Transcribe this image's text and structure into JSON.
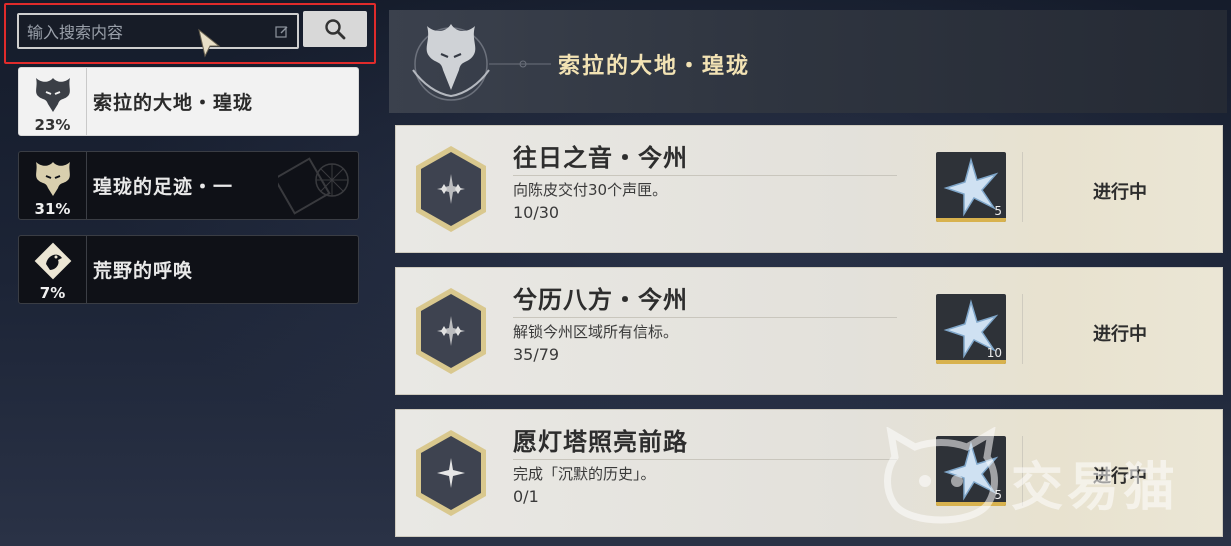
{
  "search": {
    "placeholder": "输入搜索内容",
    "button_icon": "search-icon",
    "edit_icon": "edit-icon",
    "highlight_color": "#e02b2b"
  },
  "categories": [
    {
      "label": "索拉的大地・瑝珑",
      "percent": "23%",
      "active": true,
      "icon": "dragon-emblem-icon"
    },
    {
      "label": "瑝珑的足迹・一",
      "percent": "31%",
      "active": false,
      "icon": "dragon-emblem-icon"
    },
    {
      "label": "荒野的呼唤",
      "percent": "7%",
      "active": false,
      "icon": "bird-emblem-icon"
    }
  ],
  "header": {
    "title": "索拉的大地・瑝珑",
    "title_color": "#f3e3b4",
    "icon": "dragon-emblem-icon"
  },
  "achievements": [
    {
      "name": "往日之音・今州",
      "desc": "向陈皮交付30个声匣。",
      "progress": "10/30",
      "reward_qty": "5",
      "reward_icon": "astrite-star-icon",
      "status": "进行中"
    },
    {
      "name": "兮历八方・今州",
      "desc": "解锁今州区域所有信标。",
      "progress": "35/79",
      "reward_qty": "10",
      "reward_icon": "astrite-star-icon",
      "status": "进行中"
    },
    {
      "name": "愿灯塔照亮前路",
      "desc": "完成「沉默的历史」。",
      "progress": "0/1",
      "reward_qty": "5",
      "reward_icon": "astrite-star-icon",
      "status": "进行中"
    }
  ],
  "watermark": {
    "text": "交易猫",
    "icon": "cat-logo-icon"
  },
  "colors": {
    "accent_gold": "#d8b24e",
    "card_bg": "#e9e8e4"
  }
}
